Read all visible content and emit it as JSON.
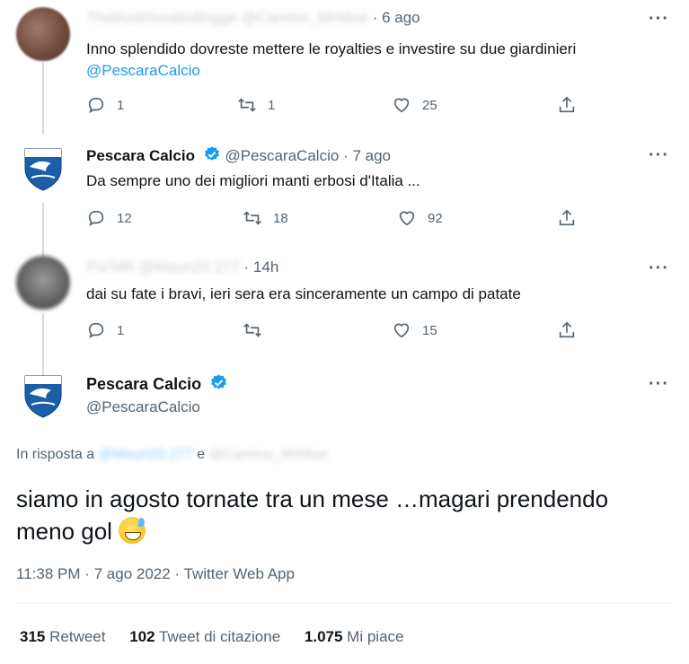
{
  "tweets": [
    {
      "author_name": "ThelliustrisoattoBngge",
      "handle": "@Camino_MrMise",
      "time": "6 ago",
      "text_line1": "Inno splendido dovreste mettere le royalties e investire su due giardinieri",
      "text_line2": "@PescaraCalcio",
      "replies": "1",
      "retweets": "1",
      "likes": "25"
    },
    {
      "author_name": "Pescara Calcio",
      "handle": "@PescaraCalcio",
      "time": "7 ago",
      "text": "Da sempre uno dei migliori manti erbosi d'Italia ...",
      "replies": "12",
      "retweets": "18",
      "likes": "92"
    },
    {
      "author_name": "Pui'MR",
      "handle": "@Maun20.277",
      "time": "14h",
      "text": "dai su fate i bravi, ieri sera era sinceramente un campo di patate",
      "replies": "1",
      "retweets": "",
      "likes": "15"
    }
  ],
  "main_tweet": {
    "author_name": "Pescara Calcio",
    "handle": "@PescaraCalcio",
    "reply_prefix": "In risposta a",
    "reply_user1": "@Maun20.277",
    "reply_and": "e",
    "reply_user2": "@Camino_MrMise",
    "text": "siamo in agosto tornate tra un mese …magari prendendo meno gol",
    "emoji": "sweat-smile-emoji",
    "timestamp": "11:38 PM · 7 ago 2022 · Twitter Web App",
    "retweets_count": "315",
    "retweets_label": "Retweet",
    "quotes_count": "102",
    "quotes_label": "Tweet di citazione",
    "likes_count": "1.075",
    "likes_label": "Mi piace"
  },
  "more_glyph": "···",
  "colors": {
    "accent": "#1d9bf0",
    "muted": "#536471",
    "text": "#0f1419",
    "club_blue": "#1b5fa8"
  },
  "icons": [
    "reply-icon",
    "retweet-icon",
    "like-icon",
    "share-icon",
    "verified-badge-icon",
    "club-logo-icon"
  ]
}
